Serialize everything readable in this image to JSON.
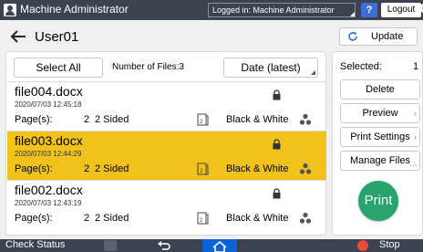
{
  "topbar": {
    "username": "Machine Administrator",
    "login_status": "Logged in: Machine Administrator",
    "help": "?",
    "logout": "Logout"
  },
  "header": {
    "title": "User01",
    "update": "Update"
  },
  "file_list": {
    "select_all": "Select All",
    "number_of_files": "Number of Files:3",
    "sort": "Date (latest)",
    "files": [
      {
        "name": "file004.docx",
        "date": "2020/07/03 12:45:18",
        "pages_label": "Page(s):",
        "pages": "2",
        "sided": "2 Sided",
        "color": "Black & White",
        "selected": false
      },
      {
        "name": "file003.docx",
        "date": "2020/07/03 12:44:29",
        "pages_label": "Page(s):",
        "pages": "2",
        "sided": "2 Sided",
        "color": "Black & White",
        "selected": true
      },
      {
        "name": "file002.docx",
        "date": "2020/07/03 12:43:19",
        "pages_label": "Page(s):",
        "pages": "2",
        "sided": "2 Sided",
        "color": "Black & White",
        "selected": false
      }
    ]
  },
  "right_panel": {
    "selected_label": "Selected:",
    "selected_count": "1",
    "delete": "Delete",
    "preview": "Preview",
    "print_settings": "Print Settings",
    "manage_files": "Manage Files",
    "print": "Print"
  },
  "bottombar": {
    "check_status": "Check Status",
    "stop": "Stop"
  },
  "colors": {
    "bar": "#3b4250",
    "selected_row": "#f1c21b",
    "print_button": "#28a36c",
    "home_button": "#0b63d6",
    "help_button": "#3d6fd6",
    "stop_icon": "#e64b3b"
  }
}
